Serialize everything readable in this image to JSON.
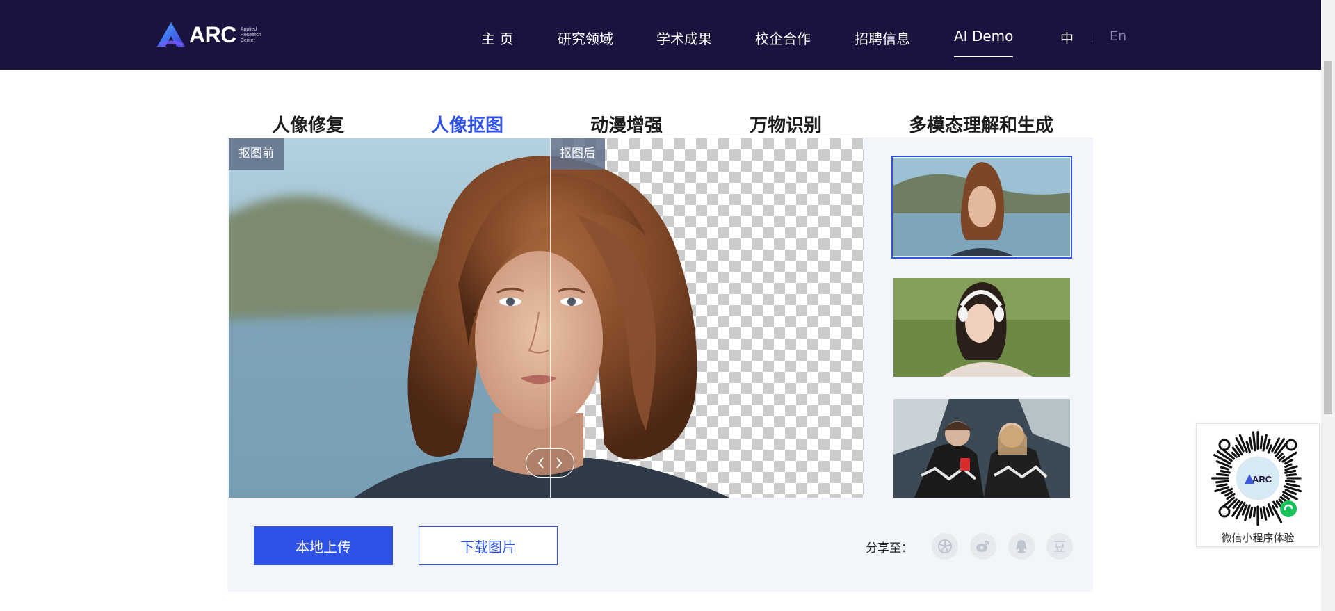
{
  "header": {
    "logo": {
      "text": "ARC",
      "sub": [
        "Applied",
        "Research",
        "Center"
      ]
    },
    "nav": [
      {
        "label": "主 页",
        "active": false
      },
      {
        "label": "研究领域",
        "active": false
      },
      {
        "label": "学术成果",
        "active": false
      },
      {
        "label": "校企合作",
        "active": false
      },
      {
        "label": "招聘信息",
        "active": false
      },
      {
        "label": "AI Demo",
        "active": true
      }
    ],
    "lang": {
      "zh": "中",
      "en": "En"
    }
  },
  "tabs": [
    {
      "label": "人像修复",
      "active": false
    },
    {
      "label": "人像抠图",
      "active": true
    },
    {
      "label": "动漫增强",
      "active": false
    },
    {
      "label": "万物识别",
      "active": false
    },
    {
      "label": "多模态理解和生成",
      "active": false
    }
  ],
  "demo": {
    "before_label": "抠图前",
    "after_label": "抠图后",
    "slider_icons": [
      "chevron-left-icon",
      "chevron-right-icon"
    ],
    "samples": [
      {
        "name": "sample-portrait-bob-hair",
        "selected": true
      },
      {
        "name": "sample-portrait-headphones",
        "selected": false
      },
      {
        "name": "sample-two-friends",
        "selected": false
      }
    ],
    "upload_button": "本地上传",
    "download_button": "下载图片",
    "share_label": "分享至：",
    "share_icons": [
      "wechat-moments-icon",
      "weibo-icon",
      "qq-icon",
      "douban-icon"
    ],
    "douban_char": "豆"
  },
  "qr": {
    "caption": "微信小程序体验",
    "logo_text": "ARC"
  },
  "colors": {
    "header_bg": "#1a1340",
    "accent": "#2e52e6",
    "panel_bg": "#f2f5fa"
  }
}
